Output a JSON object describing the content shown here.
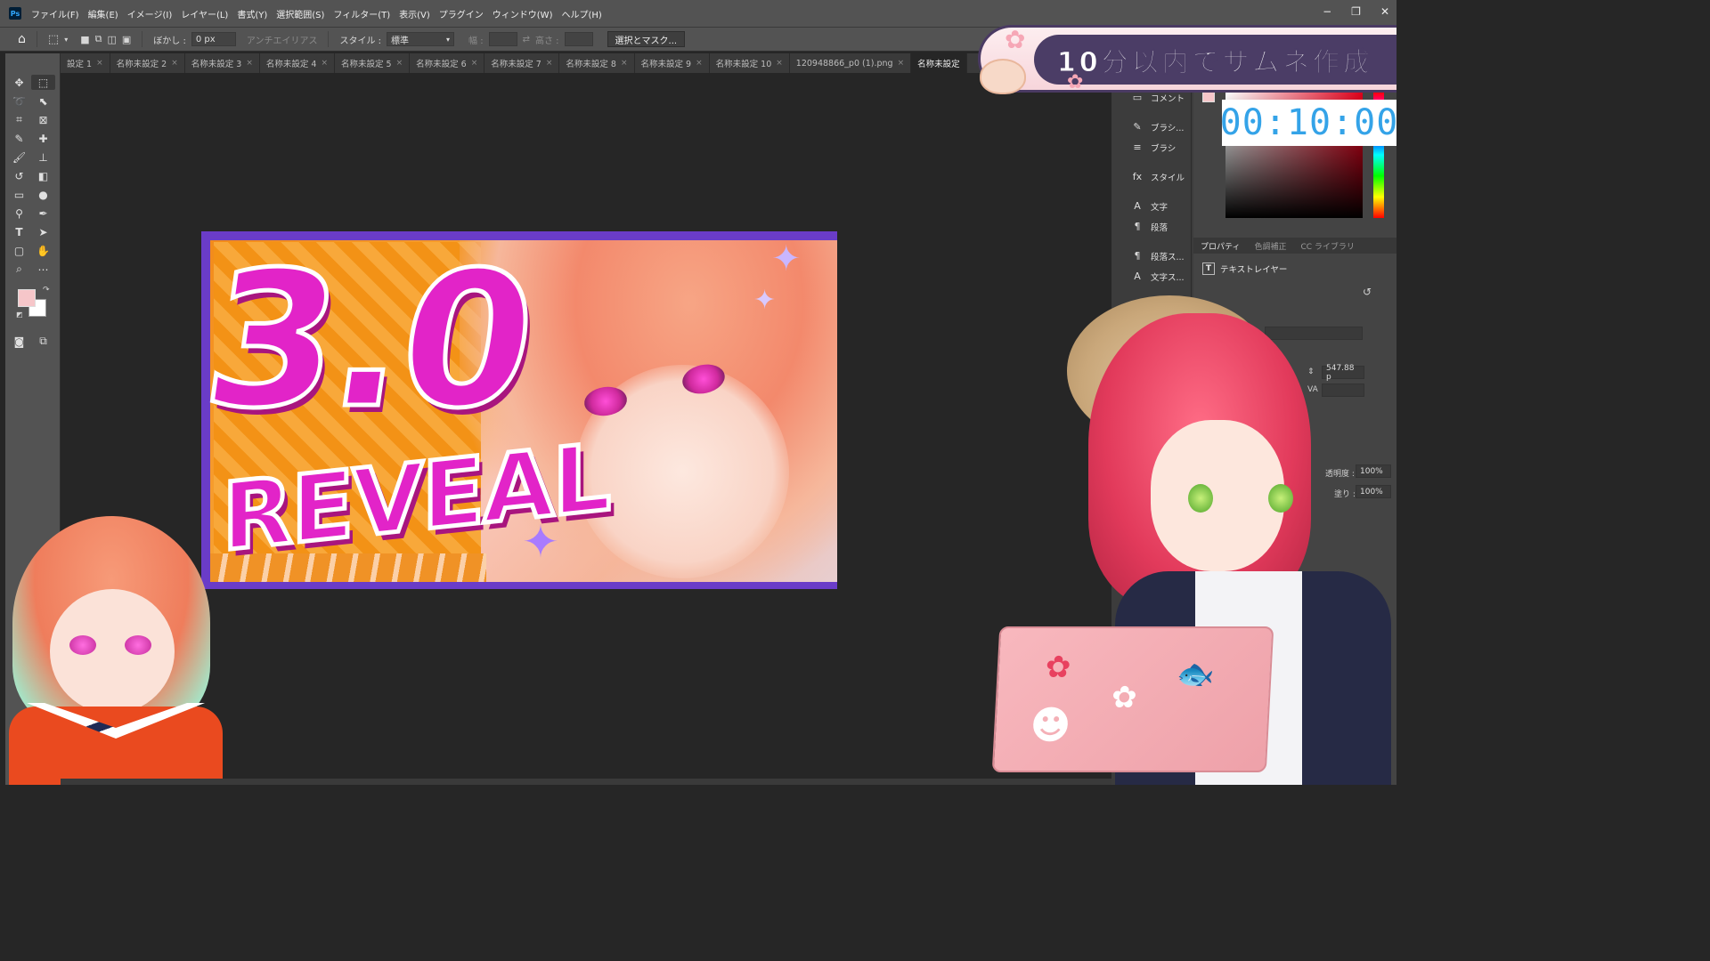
{
  "app": {
    "logo": "Ps"
  },
  "menu": [
    "ファイル(F)",
    "編集(E)",
    "イメージ(I)",
    "レイヤー(L)",
    "書式(Y)",
    "選択範囲(S)",
    "フィルター(T)",
    "表示(V)",
    "プラグイン",
    "ウィンドウ(W)",
    "ヘルプ(H)"
  ],
  "window_controls": {
    "minimize": "−",
    "restore": "❐",
    "close": "✕"
  },
  "options": {
    "feather_label": "ぼかし :",
    "feather_value": "0 px",
    "antialias_label": "アンチエイリアス",
    "style_label": "スタイル :",
    "style_value": "標準",
    "width_label": "幅 :",
    "height_label": "高さ :",
    "select_mask_button": "選択とマスク..."
  },
  "tabs": [
    "設定 1",
    "名称未設定 2",
    "名称未設定 3",
    "名称未設定 4",
    "名称未設定 5",
    "名称未設定 6",
    "名称未設定 7",
    "名称未設定 8",
    "名称未設定 9",
    "名称未設定 10",
    "120948866_p0 (1).png",
    "名称未設定"
  ],
  "canvas": {
    "big_number": "3.0",
    "word": "REVEAL"
  },
  "overlay": {
    "banner_text": "10分以内でサムネ作成",
    "timer": "00:10:00"
  },
  "panel_icons": [
    "コメント",
    "ブラシ...",
    "ブラシ",
    "スタイル",
    "文字",
    "段落",
    "段落ス...",
    "文字ス..."
  ],
  "panel_tabs": [
    "プロパティ",
    "色調補正",
    "CC ライブラリ"
  ],
  "properties": {
    "layer_type": "テキストレイヤー",
    "size_value": "547.88 p",
    "opacity_label": "透明度 :",
    "opacity_value": "100%",
    "fill_label": "塗り :",
    "fill_value": "100%"
  },
  "colors": {
    "foreground": "#f6c6c9",
    "background": "#ffffff",
    "timer_text": "#34a3e8",
    "banner_bg": "#4b3d66"
  },
  "icons": [
    "home-icon",
    "move-icon",
    "marquee-icon",
    "lasso-icon",
    "quick-select-icon",
    "crop-icon",
    "frame-icon",
    "eyedropper-icon",
    "healing-icon",
    "brush-icon",
    "stamp-icon",
    "history-brush-icon",
    "eraser-icon",
    "gradient-icon",
    "blur-icon",
    "dodge-icon",
    "pen-icon",
    "type-icon",
    "path-select-icon",
    "rectangle-icon",
    "hand-icon",
    "zoom-icon",
    "more-icon"
  ]
}
